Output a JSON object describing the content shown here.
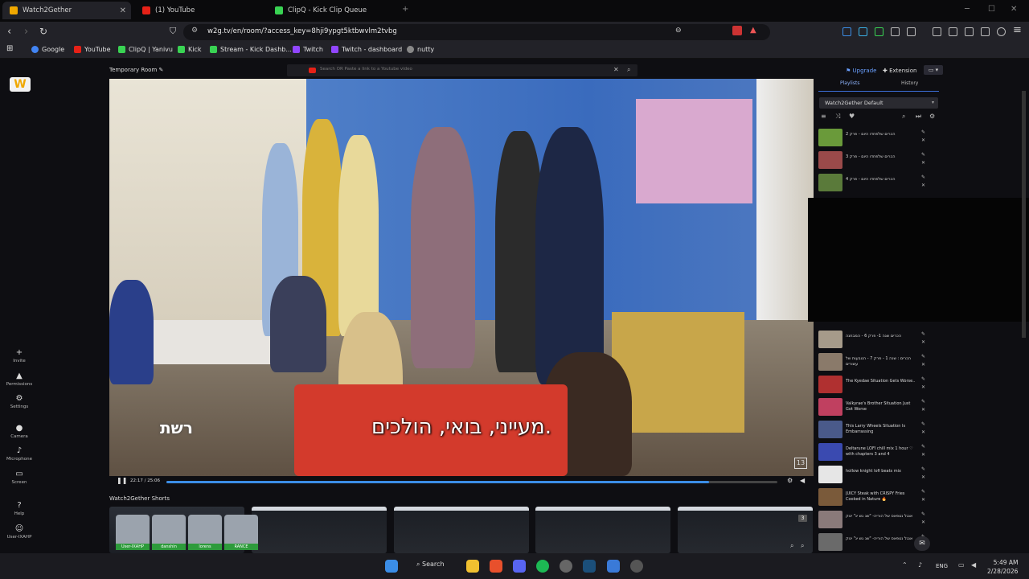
{
  "tabs": [
    {
      "title": "Watch2Gether",
      "active": true
    },
    {
      "title": "(1) YouTube",
      "active": false
    },
    {
      "title": "ClipQ - Kick Clip Queue",
      "active": false
    }
  ],
  "url": "w2g.tv/en/room/?access_key=8hji9ypgt5ktbwvlm2tvbg",
  "bookmarks": [
    "Google",
    "YouTube",
    "ClipQ | Yanivu",
    "Kick",
    "Stream - Kick Dashb...",
    "Twitch",
    "Twitch - dashboard",
    "nutty"
  ],
  "sidebar": {
    "items": [
      {
        "label": "Invite",
        "glyph": "+"
      },
      {
        "label": "Permissions",
        "glyph": "▲"
      },
      {
        "label": "Settings",
        "glyph": "⚙"
      },
      {
        "label": "Camera",
        "glyph": "●"
      },
      {
        "label": "Microphone",
        "glyph": "♪"
      },
      {
        "label": "Screen",
        "glyph": "▭"
      },
      {
        "label": "Help",
        "glyph": "?"
      },
      {
        "label": "User-IXAHP",
        "glyph": "☺"
      }
    ]
  },
  "room": {
    "name": "Temporary Room",
    "search_placeholder": "Search OR Paste a link to a Youtube video"
  },
  "player": {
    "time": "22:17 / 25:06",
    "progress": 0.888,
    "subtitle": "מעייני, בואי, הולכים.",
    "channel_logo": "רשת",
    "channel_number": "13"
  },
  "shorts": {
    "title": "Watch2Gether Shorts",
    "count_badge": "3"
  },
  "users": [
    "User-IXAHP",
    "danshin",
    "lorens",
    "RANCE"
  ],
  "panel": {
    "upgrade": "Upgrade",
    "extension": "Extension",
    "tab_playlists": "Playlists",
    "tab_history": "History",
    "playlist_name": "Watch2Gether Default",
    "items": [
      {
        "title": "הכרים שלפחדו היום - פרק 2",
        "color": "#6a9a3a"
      },
      {
        "title": "הכרים שלפחדו היום - פרק 3",
        "color": "#9a4a4a"
      },
      {
        "title": "הכרים שלפחדו היום - פרק 4",
        "color": "#5a7a3a"
      },
      {
        "title": "הכרים שנה 1- פרק 6 - המבחנה",
        "color": "#a69b8a"
      },
      {
        "title": "הכרים : שנה 1 - פרק 7 - הטבעות של עשורים",
        "color": "#8a7a6a"
      },
      {
        "title": "The Kyedae Situation Gets Worse..",
        "color": "#b03030"
      },
      {
        "title": "Valkyrae's Brother Situation Just Got Worse",
        "color": "#c04060"
      },
      {
        "title": "This Larry Wheels Situation Is Embarrassing",
        "color": "#4a5a8a"
      },
      {
        "title": "Deltarune LOFI chill mix 1 hour ♡ with chapters 3 and 4",
        "color": "#3a4ab0"
      },
      {
        "title": "hollow knight lofi beats mix",
        "color": "#e6e6e6"
      },
      {
        "title": "JUICY Steak with CRISPY Fries Cooked in Nature 🔥",
        "color": "#7a5a3a"
      },
      {
        "title": "אנגל נטפאס של הוריה- \"שנ גש ינ\" ינוק",
        "color": "#8a7a7a"
      },
      {
        "title": "אנגל נטפאס של הוריה- \"שנ גש ינ\" ינוק",
        "color": "#6a6a6a"
      }
    ]
  },
  "taskbar": {
    "search": "Search",
    "language": "ENG",
    "time": "5:49 AM",
    "date": "2/28/2026"
  }
}
